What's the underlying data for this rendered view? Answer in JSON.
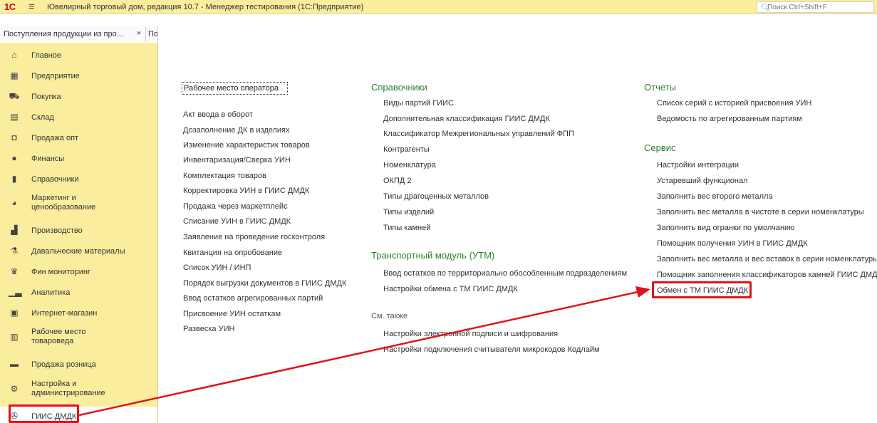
{
  "window": {
    "logo_text": "1С",
    "title": "Ювелирный торговый дом, редакция 10.7  - Менеджер тестирования (1С:Предприятие)"
  },
  "search": {
    "placeholder": "Поиск Ctrl+Shift+F",
    "icon": "search-icon"
  },
  "tabs": [
    {
      "label": "Поступления продукции из про...",
      "close": "×"
    },
    {
      "label": "По"
    }
  ],
  "sidebar": {
    "items": [
      {
        "label": "Главное",
        "icon": "home-icon"
      },
      {
        "label": "Предприятие",
        "icon": "building-icon"
      },
      {
        "label": "Покупка",
        "icon": "cart-icon"
      },
      {
        "label": "Склад",
        "icon": "warehouse-icon"
      },
      {
        "label": "Продажа опт",
        "icon": "bag-icon"
      },
      {
        "label": "Финансы",
        "icon": "coin-icon"
      },
      {
        "label": "Справочники",
        "icon": "book-icon"
      },
      {
        "label": "Маркетинг и\nценообразование",
        "icon": "pie-icon"
      },
      {
        "label": "Производство",
        "icon": "factory-icon"
      },
      {
        "label": "Давальческие материалы",
        "icon": "materials-icon"
      },
      {
        "label": "Фин мониторинг",
        "icon": "monitor-icon"
      },
      {
        "label": "Аналитика",
        "icon": "chart-icon"
      },
      {
        "label": "Интернет-магазин",
        "icon": "shop-icon"
      },
      {
        "label": "Рабочее место\nтовароведа",
        "icon": "workplace-icon"
      },
      {
        "label": "Продажа розница",
        "icon": "register-icon"
      },
      {
        "label": "Настройка и\nадминистрирование",
        "icon": "gear-icon"
      },
      {
        "label": "ГИИС ДМДК",
        "icon": "giis-icon"
      }
    ]
  },
  "col1": {
    "featured": "Рабочее место оператора",
    "links": [
      "Акт ввода в оборот",
      "Дозаполнение ДК в изделиях",
      "Изменение характеристик товаров",
      "Инвентаризация/Сверка УИН",
      "Комплектация товаров",
      "Корректировка УИН в ГИИС ДМДК",
      "Продажа через маркетплейс",
      "Списание УИН в ГИИС ДМДК",
      "Заявление на проведение госконтроля",
      "Квитанция на опробование",
      "Список УИН / ИНП",
      "Порядок выгрузки документов в ГИИС ДМДК",
      "Ввод остатков агрегированных партий",
      "Присвоение УИН остаткам",
      "Развеска УИН"
    ]
  },
  "col2": {
    "group1_title": "Справочники",
    "group1_links": [
      "Виды партий ГИИС",
      "Дополнительная классификация ГИИС ДМДК",
      "Классификатор Межрегиональных управлений ФПП",
      "Контрагенты",
      "Номенклатура",
      "ОКПД 2",
      "Типы драгоценных металлов",
      "Типы изделий",
      "Типы камней"
    ],
    "group2_title": "Транспортный модуль (УТМ)",
    "group2_links": [
      "Ввод остатков по территориально обособленным подразделениям",
      "Настройки обмена с ТМ ГИИС ДМДК"
    ],
    "group3_title": "См. также",
    "group3_links": [
      "Настройки электронной подписи и шифрования",
      "Настройки подключения считывателя микрокодов Кодлайм"
    ]
  },
  "col3": {
    "group1_title": "Отчеты",
    "group1_links": [
      "Список серий с историей присвоения УИН",
      "Ведомость по агрегированным партиям"
    ],
    "group2_title": "Сервис",
    "group2_links": [
      "Настройки интеграции",
      "Устаревший функционал",
      "Заполнить вес второго металла",
      "Заполнить вес металла в чистоте в серии номенклатуры",
      "Заполнить вид огранки по умолчанию",
      "Помощник получения УИН в ГИИС ДМДК",
      "Заполнить вес металла и вес вставок в серии номенклатуры",
      "Помощник заполнения классификаторов камней ГИИС ДМДК",
      "Обмен с ТМ ГИИС ДМДК"
    ]
  },
  "colors": {
    "sidebar_bg": "#fbed9e",
    "group_title": "#2e7d32",
    "highlight": "#e0121b"
  }
}
